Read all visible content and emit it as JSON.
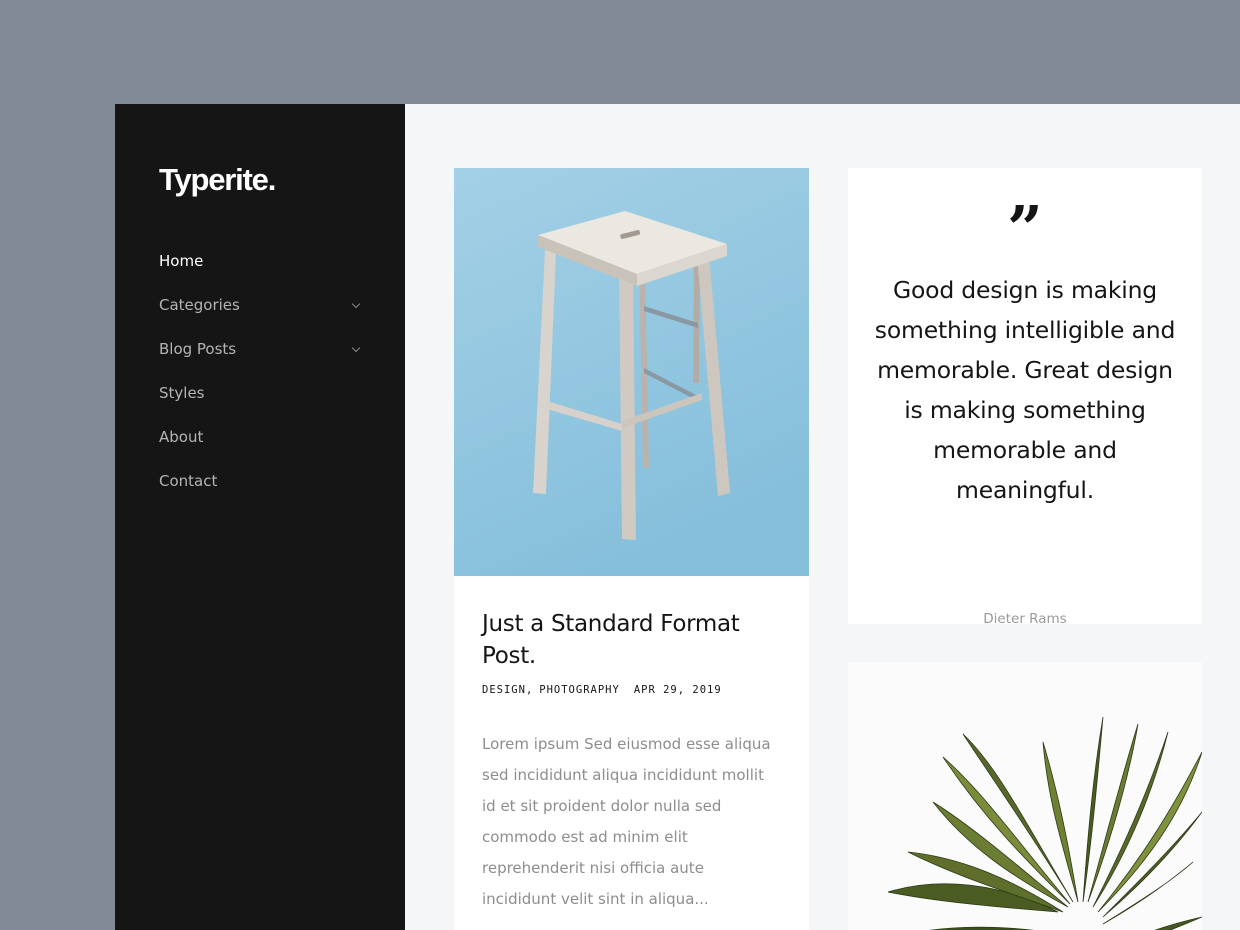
{
  "site": {
    "logo": "Typerite."
  },
  "sidebar": {
    "items": [
      {
        "label": "Home",
        "active": true,
        "has_submenu": false
      },
      {
        "label": "Categories",
        "active": false,
        "has_submenu": true
      },
      {
        "label": "Blog Posts",
        "active": false,
        "has_submenu": true
      },
      {
        "label": "Styles",
        "active": false,
        "has_submenu": false
      },
      {
        "label": "About",
        "active": false,
        "has_submenu": false
      },
      {
        "label": "Contact",
        "active": false,
        "has_submenu": false
      }
    ]
  },
  "post": {
    "image": "wooden-stool-photo",
    "title": "Just a Standard Format Post.",
    "categories": [
      "DESIGN",
      "PHOTOGRAPHY"
    ],
    "category_1": "DESIGN",
    "category_sep": ",",
    "category_2": "PHOTOGRAPHY",
    "date": "APR 29, 2019",
    "excerpt": "Lorem ipsum Sed eiusmod esse aliqua sed incididunt aliqua incididunt mollit id et sit proident dolor nulla sed commodo est ad minim elit reprehenderit nisi officia aute incididunt velit sint in aliqua..."
  },
  "quote": {
    "mark": "”",
    "text": "Good design is making something intelligible and memorable. Great design is making something memorable and meaningful.",
    "author": "Dieter Rams"
  },
  "plant_card": {
    "image": "plant-leaves-photo"
  },
  "colors": {
    "page_bg": "#828b95",
    "sidebar_bg": "#151515",
    "content_bg": "#f5f6f8",
    "card_bg": "#ffffff",
    "text_dark": "#151515",
    "text_muted": "#8d8d8d",
    "photo_bg": "#8fc5df"
  }
}
